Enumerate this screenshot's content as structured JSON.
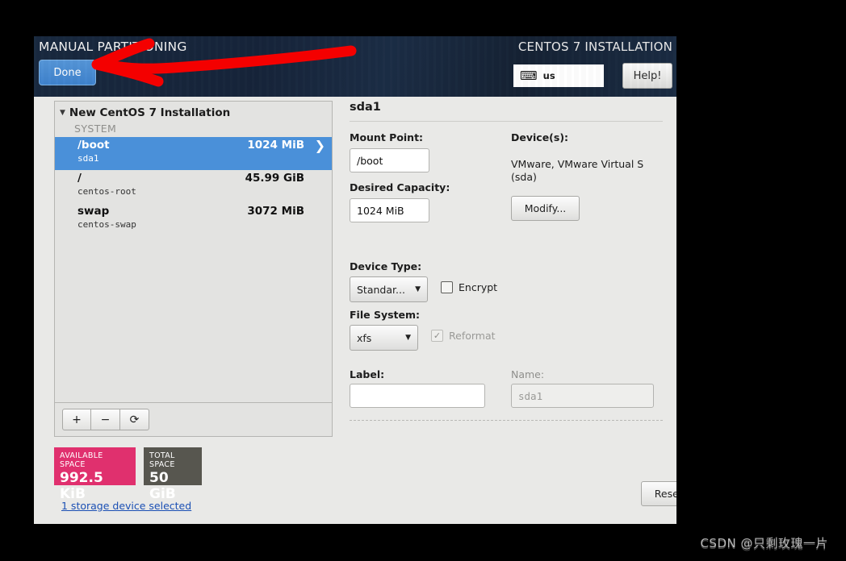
{
  "header": {
    "title": "MANUAL PARTITIONING",
    "done_label": "Done",
    "product_title": "CENTOS 7 INSTALLATION",
    "keyboard_layout": "us",
    "keyboard_icon": "keyboard-icon",
    "help_label": "Help!"
  },
  "partitioning": {
    "scheme_title": "New CentOS 7 Installation",
    "group_label": "SYSTEM",
    "partitions": [
      {
        "mount": "/boot",
        "device": "sda1",
        "size": "1024 MiB",
        "selected": true
      },
      {
        "mount": "/",
        "device": "centos-root",
        "size": "45.99 GiB",
        "selected": false
      },
      {
        "mount": "swap",
        "device": "centos-swap",
        "size": "3072 MiB",
        "selected": false
      }
    ],
    "toolbar": {
      "add": "+",
      "remove": "−",
      "refresh": "⟳"
    },
    "available_space": {
      "label": "AVAILABLE SPACE",
      "value": "992.5 KiB",
      "color": "#e0306e"
    },
    "total_space": {
      "label": "TOTAL SPACE",
      "value": "50 GiB",
      "color": "#57564f"
    },
    "storage_link": "1 storage device selected"
  },
  "detail": {
    "title": "sda1",
    "mount_point_label": "Mount Point:",
    "mount_point_value": "/boot",
    "desired_capacity_label": "Desired Capacity:",
    "desired_capacity_value": "1024 MiB",
    "devices_label": "Device(s):",
    "devices_value": "VMware, VMware Virtual S (sda)",
    "modify_label": "Modify...",
    "device_type_label": "Device Type:",
    "device_type_value": "Standar...",
    "encrypt_label": "Encrypt",
    "encrypt_checked": false,
    "file_system_label": "File System:",
    "file_system_value": "xfs",
    "reformat_label": "Reformat",
    "reformat_checked": true,
    "label_label": "Label:",
    "label_value": "",
    "name_label": "Name:",
    "name_value": "sda1",
    "reset_all_label": "Reset All"
  },
  "watermark": {
    "text": "CSDN @只剩玫瑰一片"
  }
}
